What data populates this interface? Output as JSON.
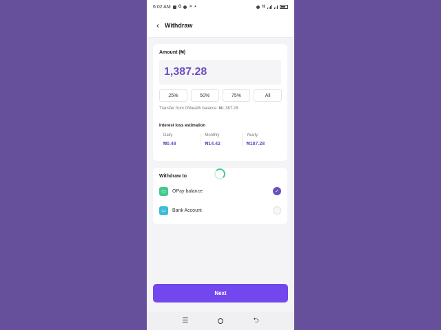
{
  "status_bar": {
    "time": "6:02 AM",
    "left_icons": [
      "notification-icon",
      "google-icon",
      "circle-icon",
      "x-icon",
      "dot-icon"
    ],
    "right_icons": [
      "alarm-icon",
      "data-speed-icon",
      "volte-icon",
      "signal-icon",
      "battery-icon"
    ]
  },
  "header": {
    "title": "Withdraw",
    "back_icon": "‹"
  },
  "amount_card": {
    "label": "Amount (₦)",
    "value": "1,387.28",
    "percent_options": [
      "25%",
      "50%",
      "75%",
      "All"
    ],
    "transfer_note_prefix": "Transfer from OWealth balance:",
    "transfer_note_amount": "₦1,387.28",
    "interest_title": "Interest loss estimation",
    "interest": [
      {
        "label": "Daily",
        "value": "₦0.48"
      },
      {
        "label": "Monthly",
        "value": "₦14.42"
      },
      {
        "label": "Yearly",
        "value": "₦187.28"
      }
    ]
  },
  "withdraw_card": {
    "title": "Withdraw to",
    "options": [
      {
        "label": "OPay balance",
        "icon": "wallet-icon",
        "selected": true
      },
      {
        "label": "Bank Account",
        "icon": "bank-icon",
        "selected": false
      }
    ]
  },
  "next_label": "Next",
  "colors": {
    "accent": "#7347ee",
    "accent_text": "#6b4fbf",
    "background": "#66509c",
    "opay_green": "#44c98e"
  }
}
